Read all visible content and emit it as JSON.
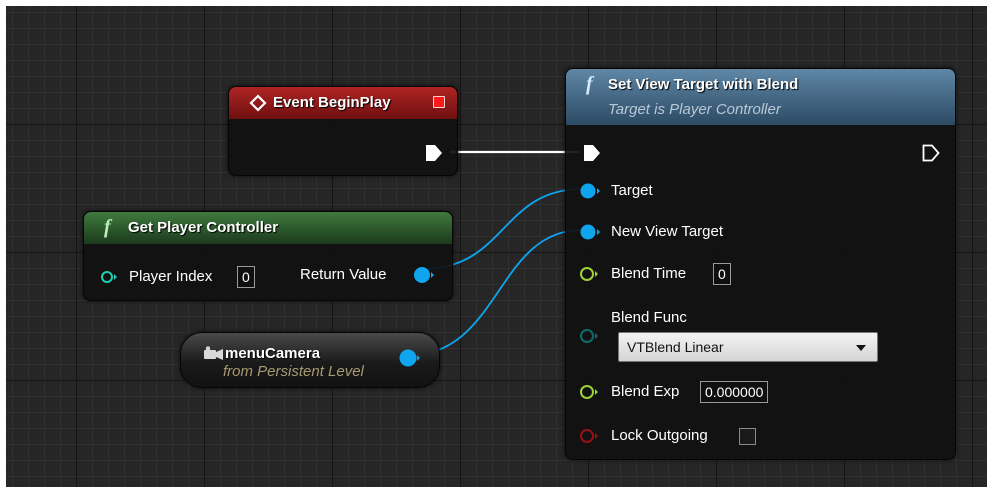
{
  "event_node": {
    "title": "Event BeginPlay"
  },
  "get_player_controller": {
    "title": "Get Player Controller",
    "input_label": "Player Index",
    "input_value": "0",
    "output_label": "Return Value"
  },
  "menu_camera": {
    "title": "menuCamera",
    "subtitle": "from Persistent Level"
  },
  "set_view_target": {
    "title": "Set View Target with Blend",
    "subtitle": "Target is Player Controller",
    "pins": {
      "target": "Target",
      "new_view_target": "New View Target",
      "blend_time": "Blend Time",
      "blend_time_value": "0",
      "blend_func": "Blend Func",
      "blend_func_value": "VTBlend Linear",
      "blend_exp": "Blend Exp",
      "blend_exp_value": "0.000000",
      "lock_outgoing": "Lock Outgoing"
    }
  },
  "colors": {
    "event_header": "#8c1818",
    "pure_function_header": "#2e5a2e",
    "function_header": "#3d6688",
    "object_pin": "#0ea5ee",
    "float_pin": "#a0d234",
    "byte_pin": "#0c6e6a",
    "bool_pin": "#9a1010",
    "exec_pin": "#ffffff"
  },
  "icons": {
    "event": "event-diamond-icon",
    "function": "function-f-icon",
    "camera": "camera-actor-icon",
    "dropdown_arrow": "triangle-down-icon"
  }
}
